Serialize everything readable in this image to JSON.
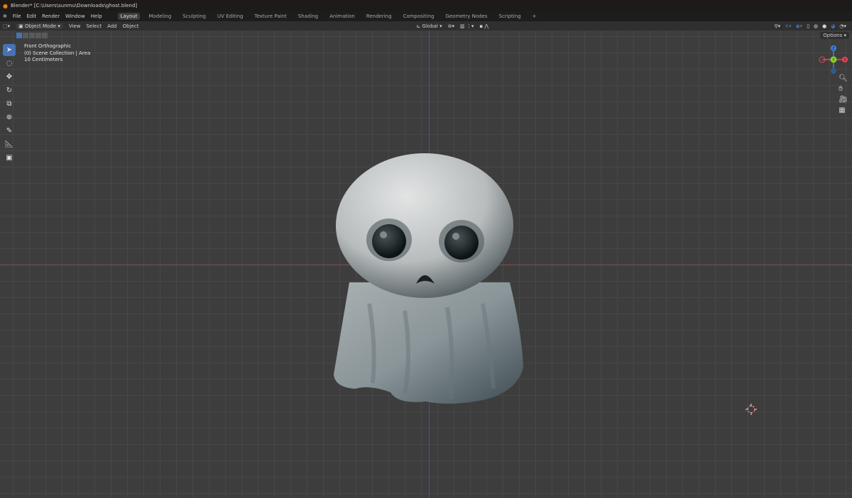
{
  "window": {
    "title": "Blender* [C:\\Users\\sunmu\\Downloads\\ghost.blend]"
  },
  "menu": [
    "File",
    "Edit",
    "Render",
    "Window",
    "Help"
  ],
  "workspaces": [
    "Layout",
    "Modeling",
    "Sculpting",
    "UV Editing",
    "Texture Paint",
    "Shading",
    "Animation",
    "Rendering",
    "Compositing",
    "Geometry Nodes",
    "Scripting",
    "+"
  ],
  "header": {
    "mode": "Object Mode",
    "menus": [
      "View",
      "Select",
      "Add",
      "Object"
    ],
    "orientation": "Global",
    "options": "Options"
  },
  "viewport": {
    "view_name": "Front Orthographic",
    "collection": "(0) Scene Collection | Area",
    "scale": "10 Centimeters"
  },
  "gizmo": {
    "x": "X",
    "y": "Y",
    "z": "Z"
  },
  "colors": {
    "accent": "#4772b3",
    "x_axis": "#e8445a",
    "y_axis": "#8bd11e",
    "z_axis": "#3f83d6"
  }
}
